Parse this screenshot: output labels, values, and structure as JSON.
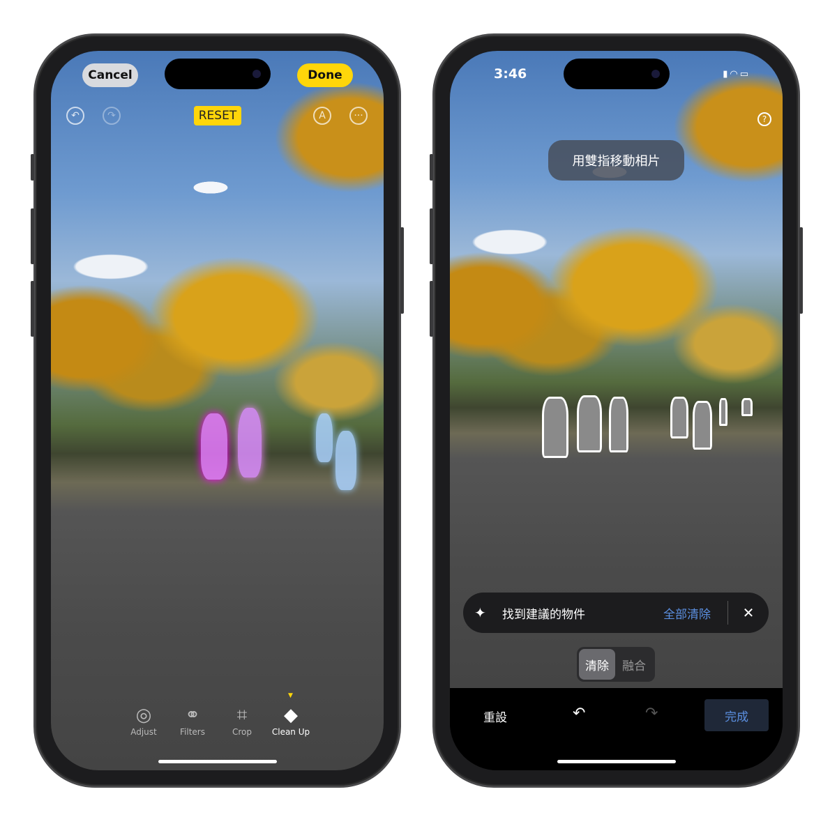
{
  "left_phone": {
    "cancel_label": "Cancel",
    "done_label": "Done",
    "reset_label": "RESET",
    "icons": {
      "undo": "undo-circle-icon",
      "redo": "redo-circle-icon",
      "markup": "pen-tip-icon",
      "more": "ellipsis-circle-icon"
    },
    "tools": [
      {
        "label": "Adjust",
        "icon": "dial-icon"
      },
      {
        "label": "Filters",
        "icon": "filters-icon"
      },
      {
        "label": "Crop",
        "icon": "crop-rotate-icon"
      },
      {
        "label": "Clean Up",
        "icon": "eraser-icon",
        "active": true
      }
    ],
    "colors": {
      "accent": "#ffd60a"
    }
  },
  "right_phone": {
    "status_time": "3:46",
    "hint": "用雙指移動相片",
    "suggestion_text": "找到建議的物件",
    "clear_all_label": "全部清除",
    "mode_options": [
      "清除",
      "融合"
    ],
    "selected_mode": "清除",
    "reset_label": "重設",
    "done_label": "完成",
    "colors": {
      "link": "#5b8fe0"
    }
  }
}
